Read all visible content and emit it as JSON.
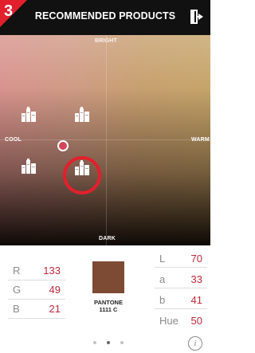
{
  "header": {
    "step": "3",
    "title": "RECOMMENDED PRODUCTS",
    "exit_icon": "exit-door-icon",
    "accent_color": "#e2202c"
  },
  "map": {
    "label_top": "BRIGHT",
    "label_bottom": "DARK",
    "label_left": "COOL",
    "label_right": "WARM",
    "product_icon": "product-bottles-icon",
    "selected_ring_color": "#e2202c",
    "marker_color": "#d4455a"
  },
  "rgb": [
    {
      "label": "R",
      "value": "133"
    },
    {
      "label": "G",
      "value": "49"
    },
    {
      "label": "B",
      "value": "21"
    }
  ],
  "swatch": {
    "color": "#7d4a33",
    "pantone_name": "PANTONE",
    "pantone_code": "1111 C"
  },
  "lab": [
    {
      "label": "L",
      "value": "70"
    },
    {
      "label": "a",
      "value": "33"
    },
    {
      "label": "b",
      "value": "41"
    },
    {
      "label": "Hue",
      "value": "50"
    }
  ],
  "pagination": {
    "pages": 3,
    "active_page": 2
  },
  "info_button": {
    "label": "i"
  }
}
